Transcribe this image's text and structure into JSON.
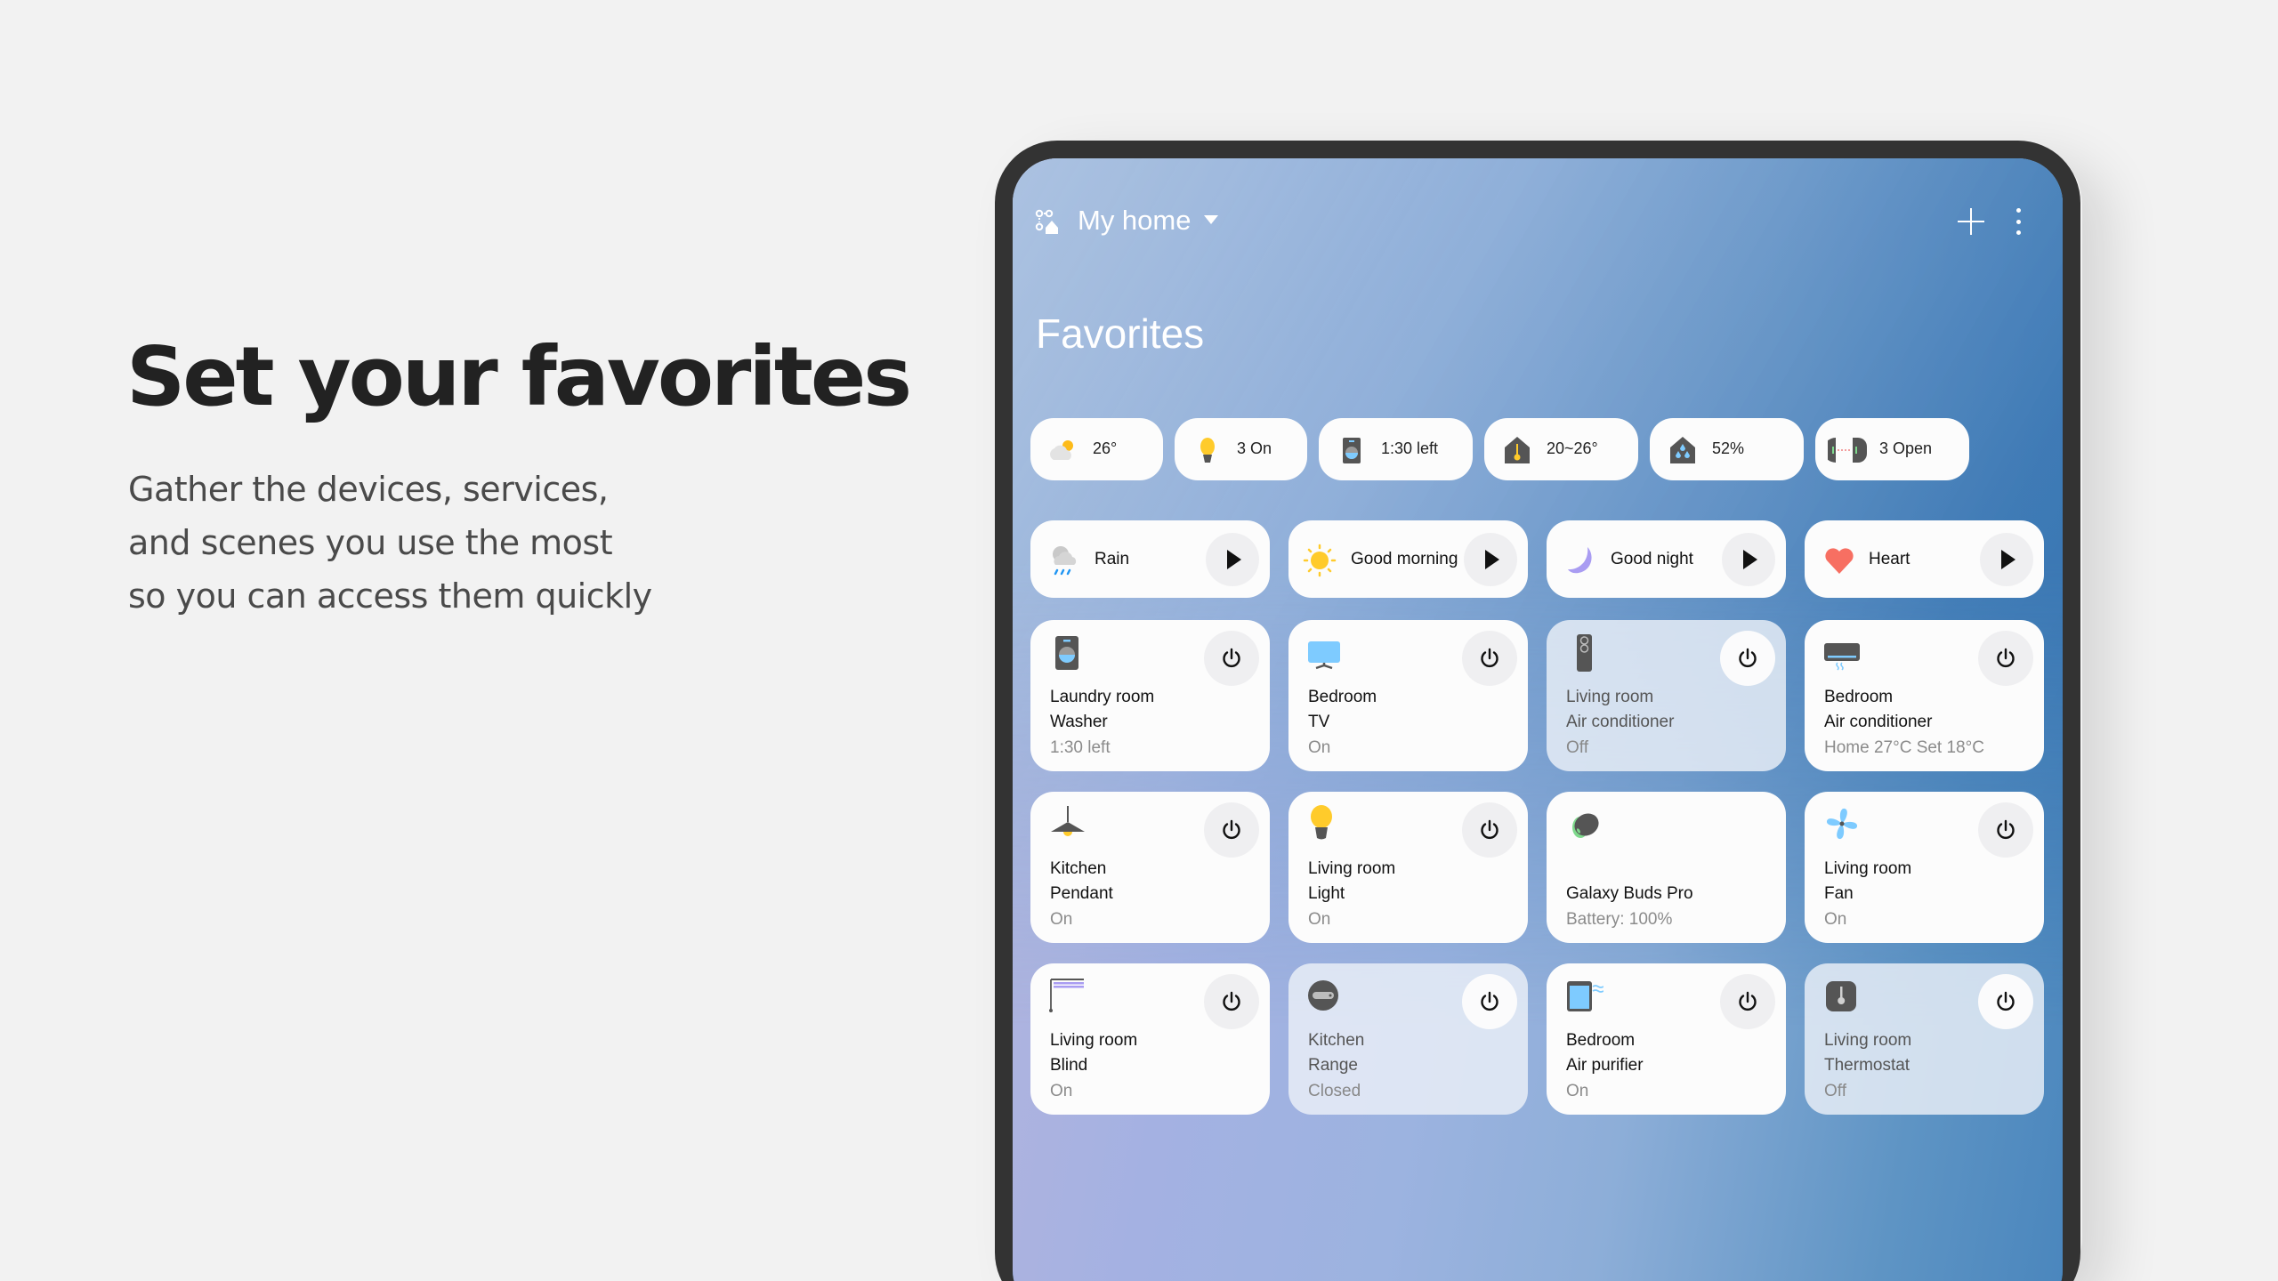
{
  "promo": {
    "title": "Set your favorites",
    "subtitle_lines": [
      "Gather the devices, services,",
      "and scenes you use the most",
      "so you can access them quickly"
    ]
  },
  "header": {
    "home_icon": "home-qr-icon",
    "home_name": "My home",
    "add_icon": "plus-icon",
    "more_icon": "more-vertical-icon"
  },
  "favorites_title": "Favorites",
  "chips": [
    {
      "icon": "weather-partly-cloudy-icon",
      "label": "26°"
    },
    {
      "icon": "lightbulb-icon",
      "label": "3 On"
    },
    {
      "icon": "washer-icon",
      "label": "1:30 left"
    },
    {
      "icon": "home-thermometer-icon",
      "label": "20~26°"
    },
    {
      "icon": "home-humidity-icon",
      "label": "52%"
    },
    {
      "icon": "door-sensor-icon",
      "label": "3 Open"
    }
  ],
  "scenes": [
    {
      "icon": "rain-cloud-icon",
      "label": "Rain"
    },
    {
      "icon": "sun-icon",
      "label": "Good morning"
    },
    {
      "icon": "moon-icon",
      "label": "Good night"
    },
    {
      "icon": "heart-icon",
      "label": "Heart"
    }
  ],
  "devices": [
    {
      "icon": "washer-icon",
      "room": "Laundry room",
      "name": "Washer",
      "status": "1:30 left",
      "state": "on",
      "has_power": true
    },
    {
      "icon": "tv-icon",
      "room": "Bedroom",
      "name": "TV",
      "status": "On",
      "state": "on",
      "has_power": true
    },
    {
      "icon": "floor-air-conditioner-icon",
      "room": "Living room",
      "name": "Air conditioner",
      "status": "Off",
      "state": "off",
      "has_power": true
    },
    {
      "icon": "wall-air-conditioner-icon",
      "room": "Bedroom",
      "name": "Air conditioner",
      "status": "Home 27°C Set 18°C",
      "state": "on",
      "has_power": true
    },
    {
      "icon": "pendant-lamp-icon",
      "room": "Kitchen",
      "name": "Pendant",
      "status": "On",
      "state": "on",
      "has_power": true
    },
    {
      "icon": "lightbulb-icon",
      "room": "Living room",
      "name": "Light",
      "status": "On",
      "state": "on",
      "has_power": true
    },
    {
      "icon": "earbuds-icon",
      "room": "",
      "name": "Galaxy Buds Pro",
      "status": "Battery: 100%",
      "state": "on",
      "has_power": false
    },
    {
      "icon": "fan-icon",
      "room": "Living room",
      "name": "Fan",
      "status": "On",
      "state": "on",
      "has_power": true
    },
    {
      "icon": "blind-icon",
      "room": "Living room",
      "name": "Blind",
      "status": "On",
      "state": "on",
      "has_power": true
    },
    {
      "icon": "range-icon",
      "room": "Kitchen",
      "name": "Range",
      "status": "Closed",
      "state": "off",
      "has_power": true
    },
    {
      "icon": "air-purifier-icon",
      "room": "Bedroom",
      "name": "Air purifier",
      "status": "On",
      "state": "on",
      "has_power": true
    },
    {
      "icon": "thermostat-icon",
      "room": "Living room",
      "name": "Thermostat",
      "status": "Off",
      "state": "off",
      "has_power": true
    }
  ],
  "colors": {
    "page_bg": "#f2f2f2",
    "tablet_bezel": "#333333",
    "card_bg": "#fcfcfc",
    "accent_yellow": "#ffcb2b",
    "accent_sky": "#7ecbff",
    "accent_purple": "#a99cf2",
    "accent_coral": "#f76f62",
    "icon_dark": "#555555"
  }
}
